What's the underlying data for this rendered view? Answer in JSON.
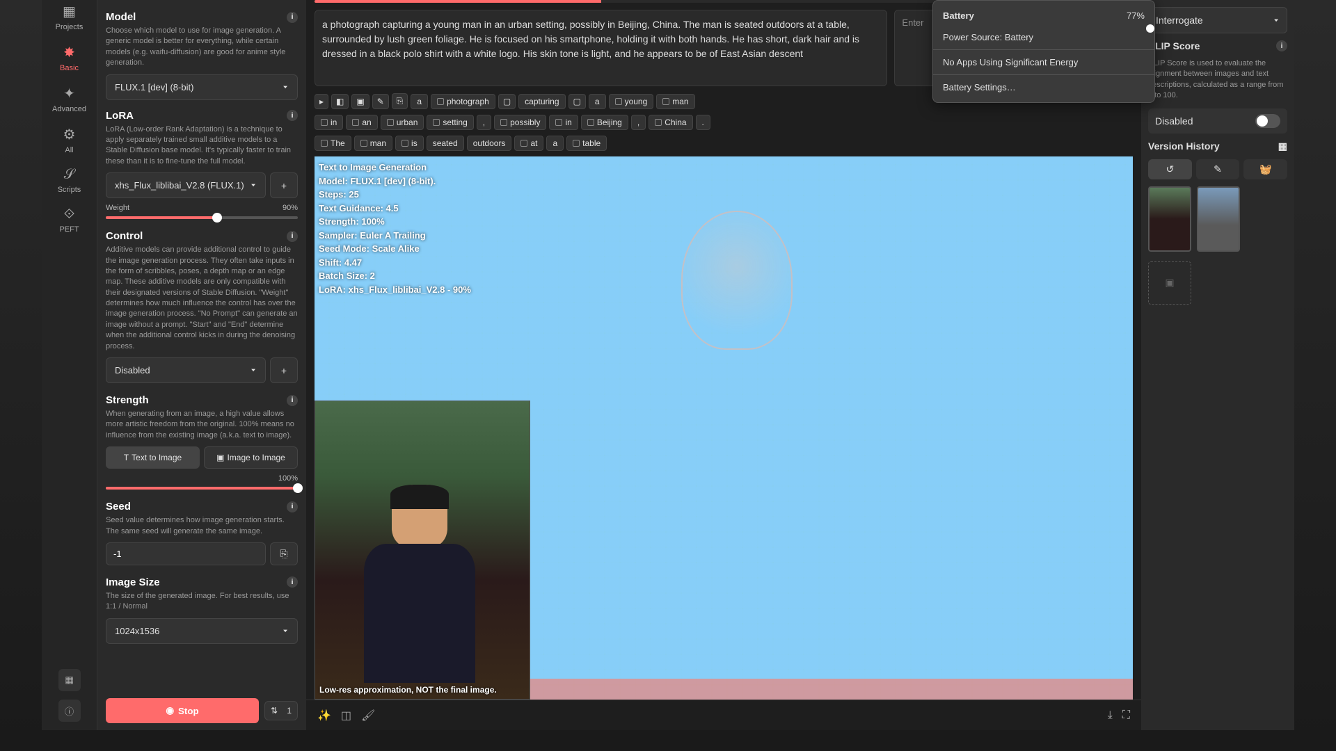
{
  "rail": {
    "projects": "Projects",
    "basic": "Basic",
    "advanced": "Advanced",
    "all": "All",
    "scripts": "Scripts",
    "peft": "PEFT"
  },
  "model": {
    "title": "Model",
    "desc": "Choose which model to use for image generation. A generic model is better for everything, while certain models (e.g. waifu-diffusion) are good for anime style generation.",
    "value": "FLUX.1 [dev] (8-bit)"
  },
  "lora": {
    "title": "LoRA",
    "desc": "LoRA (Low-order Rank Adaptation) is a technique to apply separately trained small additive models to a Stable Diffusion base model. It's typically faster to train these than it is to fine-tune the full model.",
    "value": "xhs_Flux_liblibai_V2.8 (FLUX.1)",
    "weight_label": "Weight",
    "weight_value": "90%"
  },
  "control": {
    "title": "Control",
    "desc": "Additive models can provide additional control to guide the image generation process. They often take inputs in the form of scribbles, poses, a depth map or an edge map. These additive models are only compatible with their designated versions of Stable Diffusion. \"Weight\" determines how much influence the control has over the image generation process. \"No Prompt\" can generate an image without a prompt. \"Start\" and \"End\" determine when the additional control kicks in during the denoising process.",
    "value": "Disabled"
  },
  "strength": {
    "title": "Strength",
    "desc": "When generating from an image, a high value allows more artistic freedom from the original. 100% means no influence from the existing image (a.k.a. text to image).",
    "text_mode": "Text to Image",
    "image_mode": "Image to Image",
    "value": "100%"
  },
  "seed": {
    "title": "Seed",
    "desc": "Seed value determines how image generation starts. The same seed will generate the same image.",
    "value": "-1"
  },
  "size": {
    "title": "Image Size",
    "desc": "The size of the generated image. For best results, use 1:1 / Normal",
    "value": "1024x1536"
  },
  "stop_label": "Stop",
  "batch_count": "1",
  "prompt": "a photograph capturing a young man in an urban setting, possibly in Beijing, China. The man is seated outdoors at a table, surrounded by lush green foliage. He is focused on his smartphone, holding it with both hands. He has short, dark hair and is dressed in a black polo shirt with a white logo. His skin tone is light, and he appears to be of East Asian descent",
  "neg_placeholder": "Enter",
  "tags_row1": [
    "photograph",
    "capturing",
    "a",
    "young",
    "man"
  ],
  "tags_row2": [
    "in",
    "an",
    "urban",
    "setting",
    ",",
    "possibly",
    "in",
    "Beijing",
    ",",
    "China",
    "."
  ],
  "tags_row3": [
    "The",
    "man",
    "is",
    "seated",
    "outdoors",
    "at",
    "a",
    "table"
  ],
  "overlay": {
    "title": "Text to Image Generation",
    "model": "Model: FLUX.1 [dev] (8-bit).",
    "steps": "Steps: 25",
    "guidance": "Text Guidance: 4.5",
    "strength": "Strength: 100%",
    "sampler": "Sampler: Euler A Trailing",
    "seedmode": "Seed Mode: Scale Alike",
    "shift": "Shift: 4.47",
    "batch": "Batch Size: 2",
    "lora": "LoRA: xhs_Flux_liblibai_V2.8 - 90%"
  },
  "lowres": "Low-res approximation, NOT the final image.",
  "right": {
    "interrogate": "Interrogate",
    "clip_title": "CLIP Score",
    "clip_desc": "CLIP Score is used to evaluate the alignment between images and text descriptions, calculated as a range from 0 to 100.",
    "disabled": "Disabled",
    "version": "Version History"
  },
  "battery": {
    "title": "Battery",
    "pct": "77%",
    "source": "Power Source: Battery",
    "noapps": "No Apps Using Significant Energy",
    "settings": "Battery Settings…"
  }
}
